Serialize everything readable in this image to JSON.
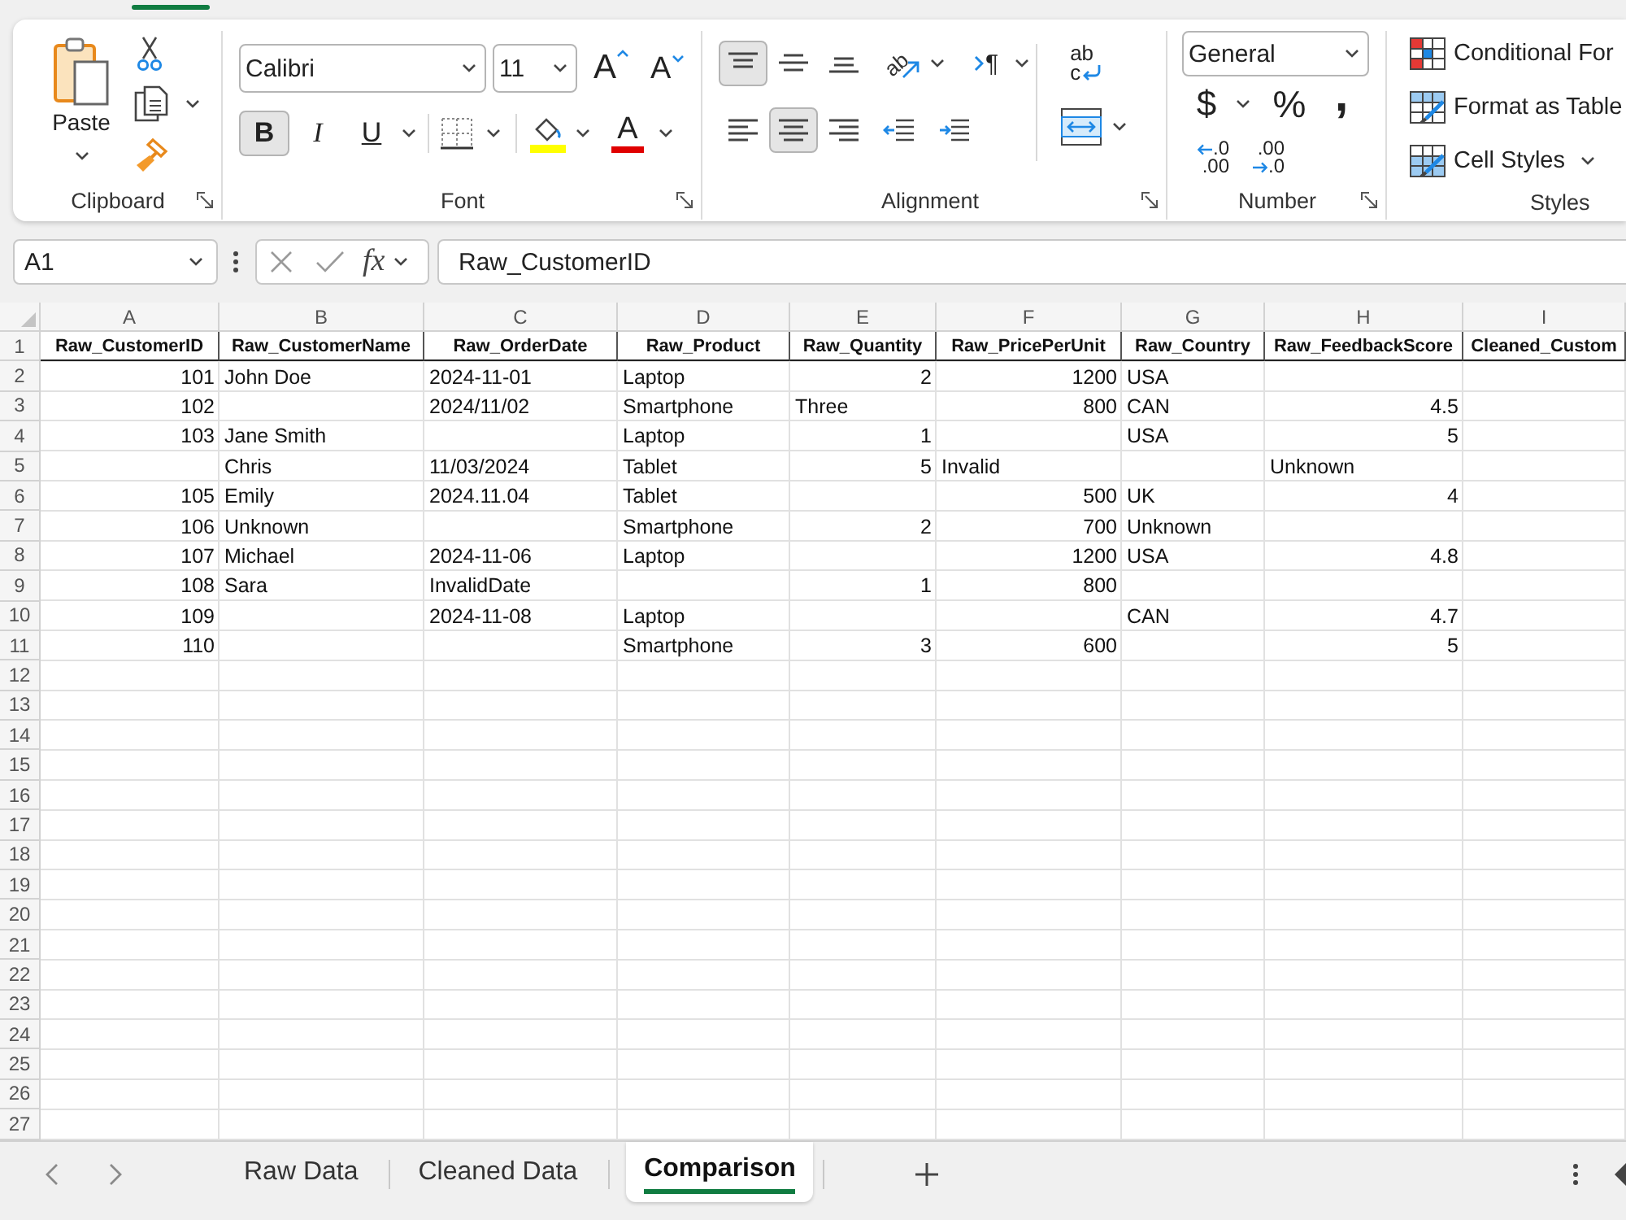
{
  "ribbon": {
    "clipboard": {
      "label": "Clipboard",
      "paste": "Paste"
    },
    "font": {
      "label": "Font",
      "font_name": "Calibri",
      "font_size": "11",
      "grow": "A",
      "shrink": "A",
      "styles": [
        {
          "label": "B",
          "kind": "bold",
          "on": true
        },
        {
          "label": "I",
          "kind": "italic",
          "on": false
        },
        {
          "label": "U",
          "kind": "underline",
          "on": false
        }
      ],
      "font_color": "A"
    },
    "alignment": {
      "label": "Alignment",
      "vertical": [
        {
          "kind": "top",
          "on": true
        },
        {
          "kind": "middle",
          "on": false
        },
        {
          "kind": "bottom",
          "on": false
        }
      ],
      "orientation": "ab",
      "text_direction": "¶",
      "horizontal": [
        {
          "kind": "left",
          "on": false
        },
        {
          "kind": "center",
          "on": true
        },
        {
          "kind": "right",
          "on": false
        }
      ],
      "indent": [
        {
          "kind": "decrease"
        },
        {
          "kind": "increase"
        }
      ],
      "wrap_text": [
        "ab",
        "c"
      ]
    },
    "number": {
      "label": "Number",
      "format": "General",
      "currency": "$",
      "percent": "%",
      "comma": ",",
      "decimals": [
        {
          "kind": "increase",
          "lines": [
            ".0",
            ".00"
          ]
        },
        {
          "kind": "decrease",
          "lines": [
            ".00",
            ".0"
          ]
        }
      ]
    },
    "styles": {
      "label": "Styles",
      "items": [
        {
          "kind": "conditional",
          "label": "Conditional For"
        },
        {
          "kind": "table",
          "label": "Format as Table"
        },
        {
          "kind": "cell_styles",
          "label": "Cell Styles",
          "dropdown": true
        }
      ]
    }
  },
  "formula_bar": {
    "name_box": "A1",
    "function_label": "fx",
    "formula": "Raw_CustomerID"
  },
  "sheet": {
    "columns": [
      "A",
      "B",
      "C",
      "D",
      "E",
      "F",
      "G",
      "H",
      "I"
    ],
    "rows": [
      {
        "number": "1",
        "cells": [
          {
            "kind": "header",
            "text": "Raw_CustomerID"
          },
          {
            "kind": "header",
            "text": "Raw_CustomerName"
          },
          {
            "kind": "header",
            "text": "Raw_OrderDate"
          },
          {
            "kind": "header",
            "text": "Raw_Product"
          },
          {
            "kind": "header",
            "text": "Raw_Quantity"
          },
          {
            "kind": "header",
            "text": "Raw_PricePerUnit"
          },
          {
            "kind": "header",
            "text": "Raw_Country"
          },
          {
            "kind": "header",
            "text": "Raw_FeedbackScore"
          },
          {
            "kind": "header",
            "text": "Cleaned_Custom"
          }
        ]
      },
      {
        "number": "2",
        "cells": [
          {
            "kind": "number",
            "text": "101"
          },
          {
            "kind": "text",
            "text": "John Doe"
          },
          {
            "kind": "text",
            "text": "2024-11-01"
          },
          {
            "kind": "text",
            "text": "Laptop"
          },
          {
            "kind": "number",
            "text": "2"
          },
          {
            "kind": "number",
            "text": "1200"
          },
          {
            "kind": "text",
            "text": "USA"
          }
        ]
      },
      {
        "number": "3",
        "cells": [
          {
            "kind": "number",
            "text": "102"
          },
          {
            "kind": "empty"
          },
          {
            "kind": "text",
            "text": "2024/11/02"
          },
          {
            "kind": "text",
            "text": "Smartphone"
          },
          {
            "kind": "text",
            "text": "Three"
          },
          {
            "kind": "number",
            "text": "800"
          },
          {
            "kind": "text",
            "text": "CAN"
          },
          {
            "kind": "number",
            "text": "4.5"
          }
        ]
      },
      {
        "number": "4",
        "cells": [
          {
            "kind": "number",
            "text": "103"
          },
          {
            "kind": "text",
            "text": "Jane Smith"
          },
          {
            "kind": "empty"
          },
          {
            "kind": "text",
            "text": "Laptop"
          },
          {
            "kind": "number",
            "text": "1"
          },
          {
            "kind": "empty"
          },
          {
            "kind": "text",
            "text": "USA"
          },
          {
            "kind": "number",
            "text": "5"
          }
        ]
      },
      {
        "number": "5",
        "cells": [
          {
            "kind": "empty"
          },
          {
            "kind": "text",
            "text": "Chris"
          },
          {
            "kind": "text",
            "text": "11/03/2024"
          },
          {
            "kind": "text",
            "text": "Tablet"
          },
          {
            "kind": "number",
            "text": "5"
          },
          {
            "kind": "text",
            "text": "Invalid"
          },
          {
            "kind": "empty"
          },
          {
            "kind": "text",
            "text": "Unknown"
          }
        ]
      },
      {
        "number": "6",
        "cells": [
          {
            "kind": "number",
            "text": "105"
          },
          {
            "kind": "text",
            "text": "Emily"
          },
          {
            "kind": "text",
            "text": "2024.11.04"
          },
          {
            "kind": "text",
            "text": "Tablet"
          },
          {
            "kind": "empty"
          },
          {
            "kind": "number",
            "text": "500"
          },
          {
            "kind": "text",
            "text": "UK"
          },
          {
            "kind": "number",
            "text": "4"
          }
        ]
      },
      {
        "number": "7",
        "cells": [
          {
            "kind": "number",
            "text": "106"
          },
          {
            "kind": "text",
            "text": "Unknown"
          },
          {
            "kind": "empty"
          },
          {
            "kind": "text",
            "text": "Smartphone"
          },
          {
            "kind": "number",
            "text": "2"
          },
          {
            "kind": "number",
            "text": "700"
          },
          {
            "kind": "text",
            "text": "Unknown"
          }
        ]
      },
      {
        "number": "8",
        "cells": [
          {
            "kind": "number",
            "text": "107"
          },
          {
            "kind": "text",
            "text": "Michael"
          },
          {
            "kind": "text",
            "text": "2024-11-06"
          },
          {
            "kind": "text",
            "text": "Laptop"
          },
          {
            "kind": "empty"
          },
          {
            "kind": "number",
            "text": "1200"
          },
          {
            "kind": "text",
            "text": "USA"
          },
          {
            "kind": "number",
            "text": "4.8"
          }
        ]
      },
      {
        "number": "9",
        "cells": [
          {
            "kind": "number",
            "text": "108"
          },
          {
            "kind": "text",
            "text": "Sara"
          },
          {
            "kind": "text",
            "text": "InvalidDate"
          },
          {
            "kind": "empty"
          },
          {
            "kind": "number",
            "text": "1"
          },
          {
            "kind": "number",
            "text": "800"
          }
        ]
      },
      {
        "number": "10",
        "cells": [
          {
            "kind": "number",
            "text": "109"
          },
          {
            "kind": "empty"
          },
          {
            "kind": "text",
            "text": "2024-11-08"
          },
          {
            "kind": "text",
            "text": "Laptop"
          },
          {
            "kind": "empty"
          },
          {
            "kind": "empty"
          },
          {
            "kind": "text",
            "text": "CAN"
          },
          {
            "kind": "number",
            "text": "4.7"
          }
        ]
      },
      {
        "number": "11",
        "cells": [
          {
            "kind": "number",
            "text": "110"
          },
          {
            "kind": "empty"
          },
          {
            "kind": "empty"
          },
          {
            "kind": "text",
            "text": "Smartphone"
          },
          {
            "kind": "number",
            "text": "3"
          },
          {
            "kind": "number",
            "text": "600"
          },
          {
            "kind": "empty"
          },
          {
            "kind": "number",
            "text": "5"
          }
        ]
      },
      {
        "number": "12"
      },
      {
        "number": "13"
      },
      {
        "number": "14"
      },
      {
        "number": "15"
      },
      {
        "number": "16"
      },
      {
        "number": "17"
      },
      {
        "number": "18"
      },
      {
        "number": "19"
      },
      {
        "number": "20"
      },
      {
        "number": "21"
      },
      {
        "number": "22"
      },
      {
        "number": "23"
      },
      {
        "number": "24"
      },
      {
        "number": "25"
      },
      {
        "number": "26"
      },
      {
        "number": "27"
      }
    ]
  },
  "sheet_tabs": [
    {
      "label": "Raw Data",
      "selected": false
    },
    {
      "label": "Cleaned Data",
      "selected": false
    },
    {
      "label": "Comparison",
      "selected": true
    }
  ]
}
